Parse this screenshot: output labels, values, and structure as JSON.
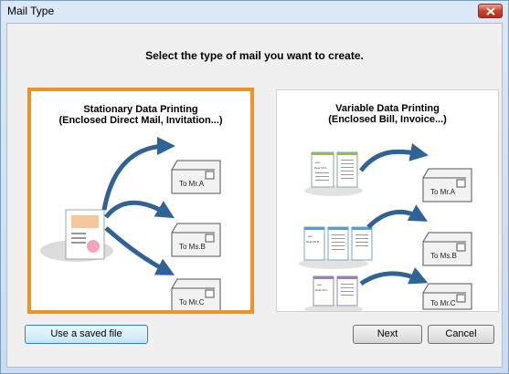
{
  "window": {
    "title": "Mail Type"
  },
  "prompt": "Select the type of mail you want to create.",
  "options": [
    {
      "title_line1": "Stationary Data Printing",
      "title_line2": "(Enclosed Direct Mail, Invitation...)",
      "selected": true,
      "recipients": [
        "To Mr.A",
        "To Ms.B",
        "To Mr.C"
      ]
    },
    {
      "title_line1": "Variable Data Printing",
      "title_line2": "(Enclosed Bill, Invoice...)",
      "selected": false,
      "recipients": [
        "To Mr.A",
        "To Ms.B",
        "To Mr.C"
      ],
      "doc_labels": [
        "Dear Mr.A",
        "Dear Ms.B",
        "Dear Mr.C"
      ]
    }
  ],
  "buttons": {
    "use_saved": "Use a saved file",
    "next": "Next",
    "cancel": "Cancel"
  },
  "colors": {
    "selection": "#f0922a",
    "arrow": "#2f6296"
  }
}
